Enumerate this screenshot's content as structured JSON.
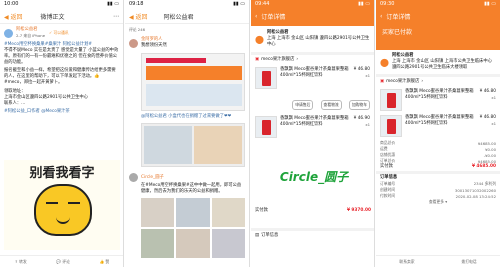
{
  "p1": {
    "status": "10:00",
    "back": "◀ 返回",
    "title": "微博正文",
    "user": "阿松公益君",
    "user_tag": "✓ 可以通讯",
    "time": "2-7 来自 iPhone",
    "text1": "#Meco用空杯换桑果#桑果汁 阿松公益计划#",
    "text2": "不得不说Meco 实在是太贵了 感觉是大量了 小蓝公益的中效率。原有们的一有一份最难和优德之的 但在食的营养价值公益的功能。",
    "text3": "报名截至和小益一样，希望把这份爱和健康传达给更多需要的人，在这里的帮助下，可以下单发起下活动。👍 #meco，郑拉一起开黄萝卜。",
    "address_label": "领取地址：",
    "address": "上海市金山区遵四公路2901号公共卫生中心",
    "contact": "联系人：...",
    "tags": "#阿松公益_口作者 @Meco果汁茶",
    "meme_text": "别看我看字",
    "actions": [
      "⇪ 转发",
      "💬 评论",
      "👍 赞"
    ]
  },
  "p2": {
    "status": "09:18",
    "back": "◀ 返回",
    "title": "阿松公益君",
    "comments_count": "评论 246",
    "c1_user": "金阿罗的人",
    "c1_text": "我想领份天然",
    "repost_text": "@阿松公益君 小盒代也在捐赠了过来要做了❤❤",
    "c2_user": "Circle_圆子",
    "c2_text": "在#Meco用空杯换桑果#这中中做一起用，即可公益健康，然后去为我们的乐天的公益和捐赠。"
  },
  "p3": {
    "status": "09:44",
    "title": "订单详情",
    "name": "阿松公益君",
    "address": "上海 上海市 金山区 山阳镇 遵四公路2901号公共卫生中心",
    "shop": "meco果汁旗舰店",
    "products": [
      {
        "name": "香飘飘 Meco蜜谷果汁茶桑葚果整箱400ml*15杯网红饮料",
        "price": "¥ 46.80",
        "qty": "x1"
      },
      {
        "name": "香飘飘 Meco蜜谷果汁茶桑葚果整箱400ml*15杯网红饮料",
        "price": "¥ 46.90",
        "qty": "x1"
      }
    ],
    "buttons": [
      "申请售后",
      "查看物流",
      "加购物车"
    ],
    "watermark": "Circle_圆子",
    "pay_label": "实付款",
    "pay_value": "¥ 9370.00",
    "info_label": "订单信息"
  },
  "p4": {
    "status": "09:30",
    "title": "订单详情",
    "banner": "买家已付款",
    "name": "阿松公益君",
    "address": "上海 上海市 金山区 山阳镇 上海市公共卫生临床中心 遵四公路2901号公共卫生临床大楼领取",
    "shop": "meco果汁旗舰店",
    "products": [
      {
        "name": "香飘飘 Meco蜜谷果汁茶桑葚果整箱400ml*15杯网红饮料",
        "price": "¥ 46.80",
        "qty": "x1"
      },
      {
        "name": "香飘飘 Meco蜜谷果汁茶桑葚果整箱400ml*15杯网红饮料",
        "price": "¥ 46.80",
        "qty": "x1"
      }
    ],
    "summary": [
      {
        "k": "商品总价",
        "v": "¥4685.00"
      },
      {
        "k": "运费",
        "v": "¥0.00"
      },
      {
        "k": "店铺优惠",
        "v": "-¥0.00"
      },
      {
        "k": "订单总价",
        "v": "¥4685.00"
      }
    ],
    "pay_label": "实付款",
    "pay_value": "¥ 4685.00",
    "info_label": "订单信息",
    "info": [
      {
        "k": "订单编号",
        "v": "2344 多利列"
      },
      {
        "k": "创建时间",
        "v": "30013071032002260"
      },
      {
        "k": "付款时间",
        "v": "2020-02-08 13:24:52"
      }
    ],
    "more": "查看更多 ▾",
    "actions": [
      "联系卖家",
      "拨打电话"
    ]
  }
}
